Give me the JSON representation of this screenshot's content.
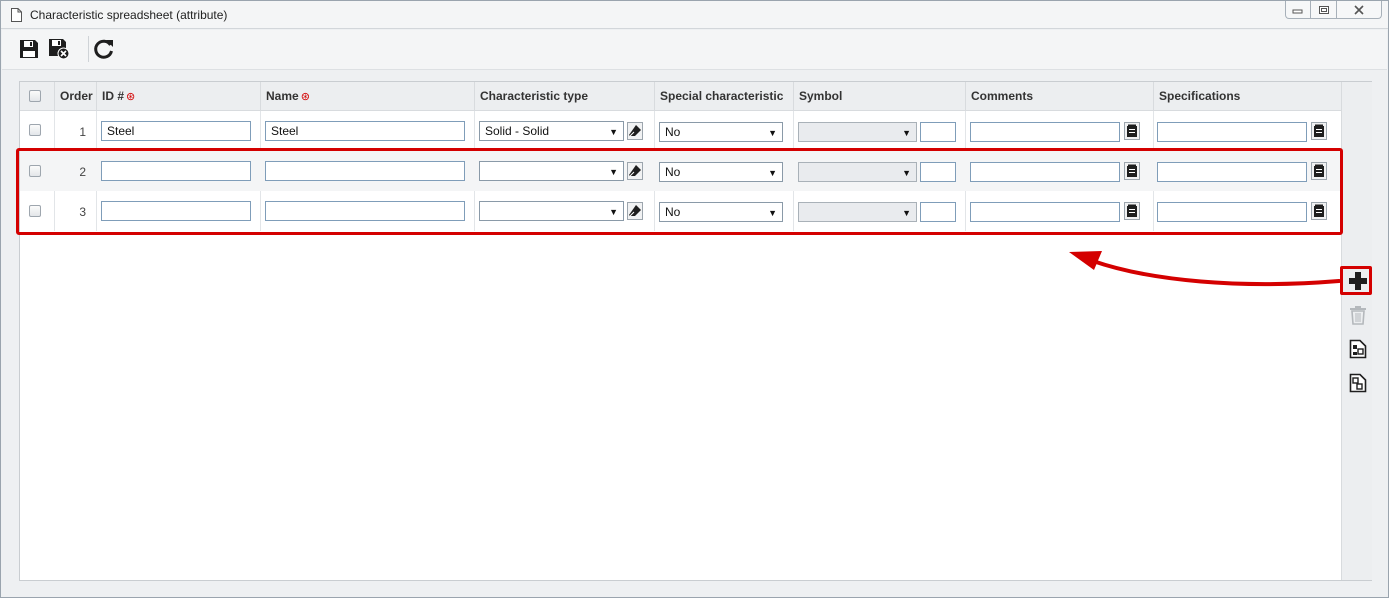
{
  "window": {
    "title": "Characteristic spreadsheet (attribute)",
    "controls": [
      "minimize-icon",
      "restore-icon",
      "close-icon"
    ]
  },
  "toolbar": {
    "buttons": [
      "save-icon",
      "save-and-close-icon",
      "refresh-icon"
    ]
  },
  "grid": {
    "columns": {
      "order": "Order",
      "id": "ID #",
      "name": "Name",
      "characteristic_type": "Characteristic type",
      "special_characteristic": "Special characteristic",
      "symbol": "Symbol",
      "comments": "Comments",
      "specifications": "Specifications"
    },
    "required_marker": "⊛",
    "rows": [
      {
        "order": "1",
        "id": "Steel",
        "name": "Steel",
        "characteristic_type": "Solid - Solid",
        "special_characteristic": "No",
        "symbol": "",
        "comments": "",
        "specifications": ""
      },
      {
        "order": "2",
        "id": "",
        "name": "",
        "characteristic_type": "",
        "special_characteristic": "No",
        "symbol": "",
        "comments": "",
        "specifications": ""
      },
      {
        "order": "3",
        "id": "",
        "name": "",
        "characteristic_type": "",
        "special_characteristic": "No",
        "symbol": "",
        "comments": "",
        "specifications": ""
      }
    ]
  },
  "side_actions": [
    "add-row-icon",
    "delete-row-icon",
    "paste-row-icon",
    "copy-row-icon"
  ],
  "annotation": {
    "highlight_color": "#d40000"
  },
  "colors": {
    "accent_red": "#d40000",
    "input_border": "#7f9db9",
    "header_bg": "#eceef0"
  }
}
